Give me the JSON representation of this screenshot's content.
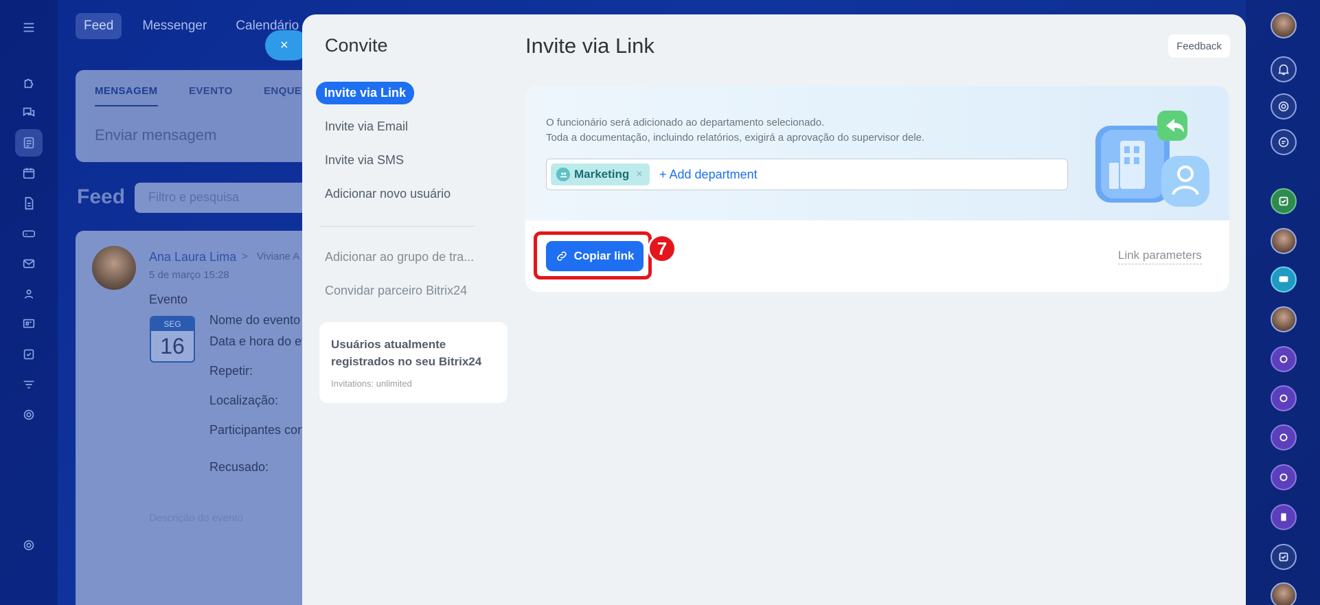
{
  "background": {
    "nav": [
      "Feed",
      "Messenger",
      "Calendário"
    ],
    "composer_tabs": [
      "MENSAGEM",
      "EVENTO",
      "ENQUETE"
    ],
    "composer_placeholder": "Enviar mensagem",
    "feed_title": "Feed",
    "filter_placeholder": "Filtro e pesquisa",
    "post": {
      "author": "Ana Laura Lima",
      "arrow": ">",
      "recipient": "Viviane A",
      "date": "5 de março 15:28",
      "type": "Evento",
      "calendar_weekday": "SEG",
      "calendar_day": "16",
      "fields": [
        "Nome do evento",
        "Data e hora do ev",
        "Repetir:",
        "Localização:",
        "Participantes con",
        "Recusado:"
      ],
      "description": "Descrição do evento"
    }
  },
  "slider": {
    "close_symbol": "×",
    "menu_title": "Convite",
    "menu_items": [
      "Invite via Link",
      "Invite via Email",
      "Invite via SMS",
      "Adicionar novo usuário"
    ],
    "menu_items_secondary": [
      "Adicionar ao grupo de tra...",
      "Convidar parceiro Bitrix24"
    ],
    "info_card": {
      "title": "Usuários atualmente registrados no seu Bitrix24",
      "subtitle": "Invitations: unlimited"
    },
    "content_title": "Invite via Link",
    "feedback_label": "Feedback",
    "notice_line1": "O funcionário será adicionado ao departamento selecionado.",
    "notice_line2": "Toda a documentação, incluindo relatórios, exigirá a aprovação do supervisor dele.",
    "department_tag": "Marketing",
    "remove_symbol": "×",
    "add_department": "+ Add department",
    "copy_link": "Copiar link",
    "step_number": "7",
    "link_parameters": "Link parameters"
  },
  "colors": {
    "accent": "#1e6ff1",
    "highlight": "#e3161c",
    "department_tag": "#bdebeb"
  }
}
